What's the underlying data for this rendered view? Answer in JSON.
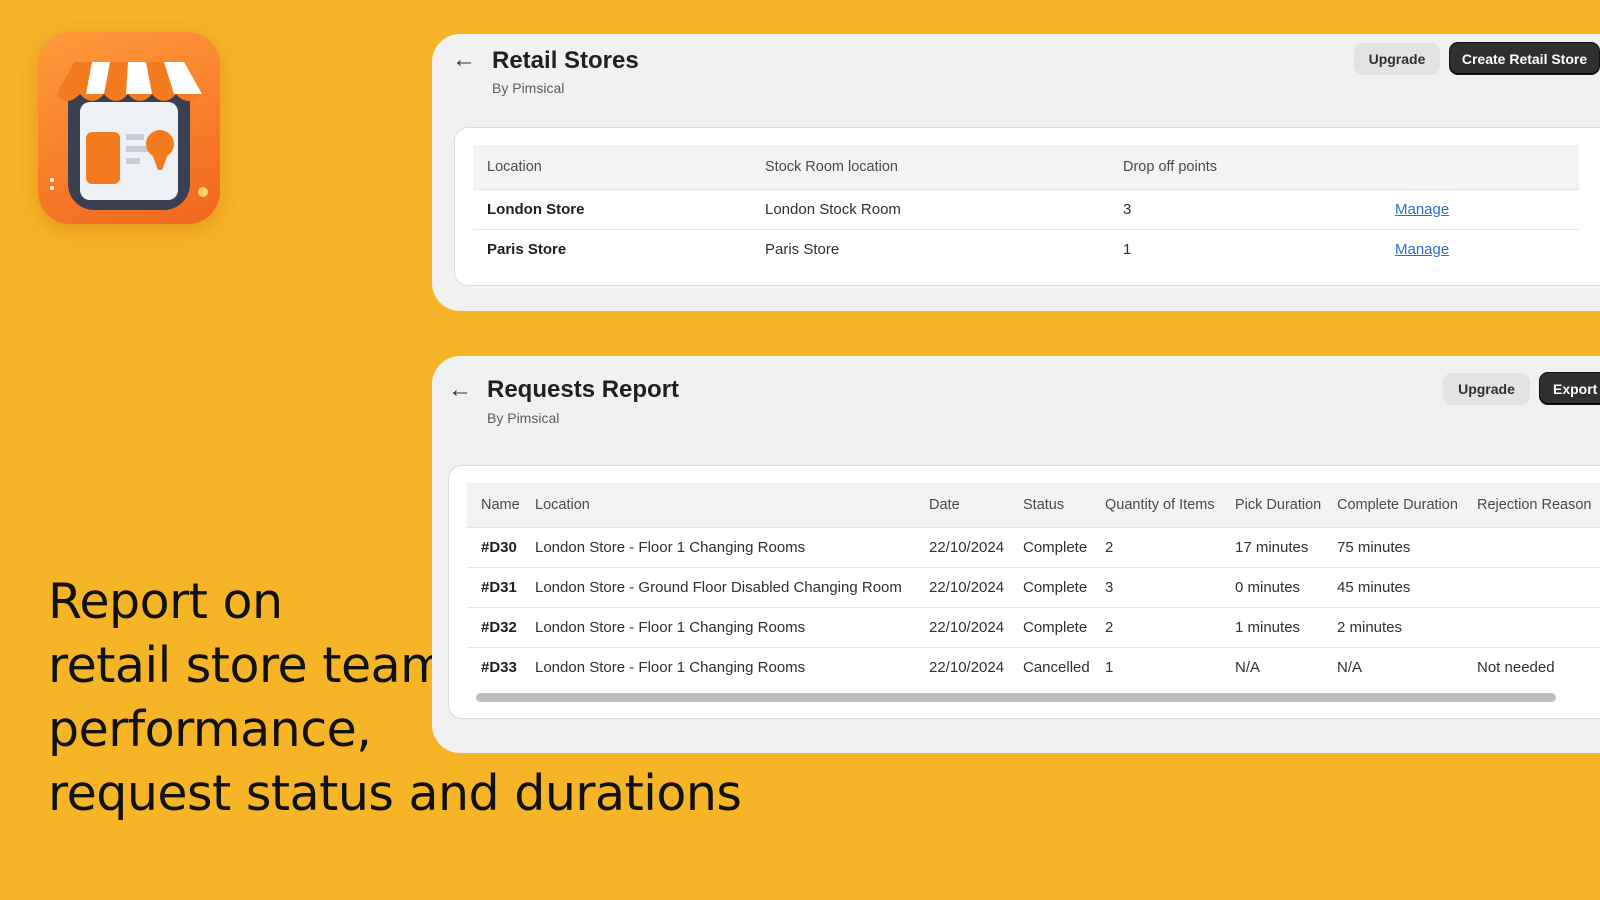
{
  "headline": {
    "lines": [
      "Report on",
      "retail store team",
      "performance,",
      "request status and durations"
    ]
  },
  "app_icon": {
    "name": "storefront-icon"
  },
  "stores_page": {
    "title": "Retail Stores",
    "subtitle": "By Pimsical",
    "upgrade_label": "Upgrade",
    "create_label": "Create Retail Store",
    "columns": [
      "Location",
      "Stock Room location",
      "Drop off points",
      ""
    ],
    "rows": [
      {
        "location": "London Store",
        "stock_room": "London Stock Room",
        "drop_off": "3",
        "action": "Manage"
      },
      {
        "location": "Paris Store",
        "stock_room": "Paris Store",
        "drop_off": "1",
        "action": "Manage"
      }
    ]
  },
  "report_page": {
    "title": "Requests Report",
    "subtitle": "By Pimsical",
    "upgrade_label": "Upgrade",
    "export_label": "Export",
    "columns": [
      "Name",
      "Location",
      "Date",
      "Status",
      "Quantity of Items",
      "Pick Duration",
      "Complete Duration",
      "Rejection Reason"
    ],
    "rows": [
      {
        "name": "#D30",
        "location": "London Store - Floor 1 Changing Rooms",
        "date": "22/10/2024",
        "status": "Complete",
        "qty": "2",
        "pick": "17 minutes",
        "complete": "75 minutes",
        "rejection": ""
      },
      {
        "name": "#D31",
        "location": "London Store - Ground Floor Disabled Changing Room",
        "date": "22/10/2024",
        "status": "Complete",
        "qty": "3",
        "pick": "0 minutes",
        "complete": "45 minutes",
        "rejection": ""
      },
      {
        "name": "#D32",
        "location": "London Store - Floor 1 Changing Rooms",
        "date": "22/10/2024",
        "status": "Complete",
        "qty": "2",
        "pick": "1 minutes",
        "complete": "2 minutes",
        "rejection": ""
      },
      {
        "name": "#D33",
        "location": "London Store - Floor 1 Changing Rooms",
        "date": "22/10/2024",
        "status": "Cancelled",
        "qty": "1",
        "pick": "N/A",
        "complete": "N/A",
        "rejection": "Not needed"
      }
    ]
  },
  "colors": {
    "background": "#f6b427",
    "primary_button": "#303030",
    "link": "#2c6ecb"
  }
}
